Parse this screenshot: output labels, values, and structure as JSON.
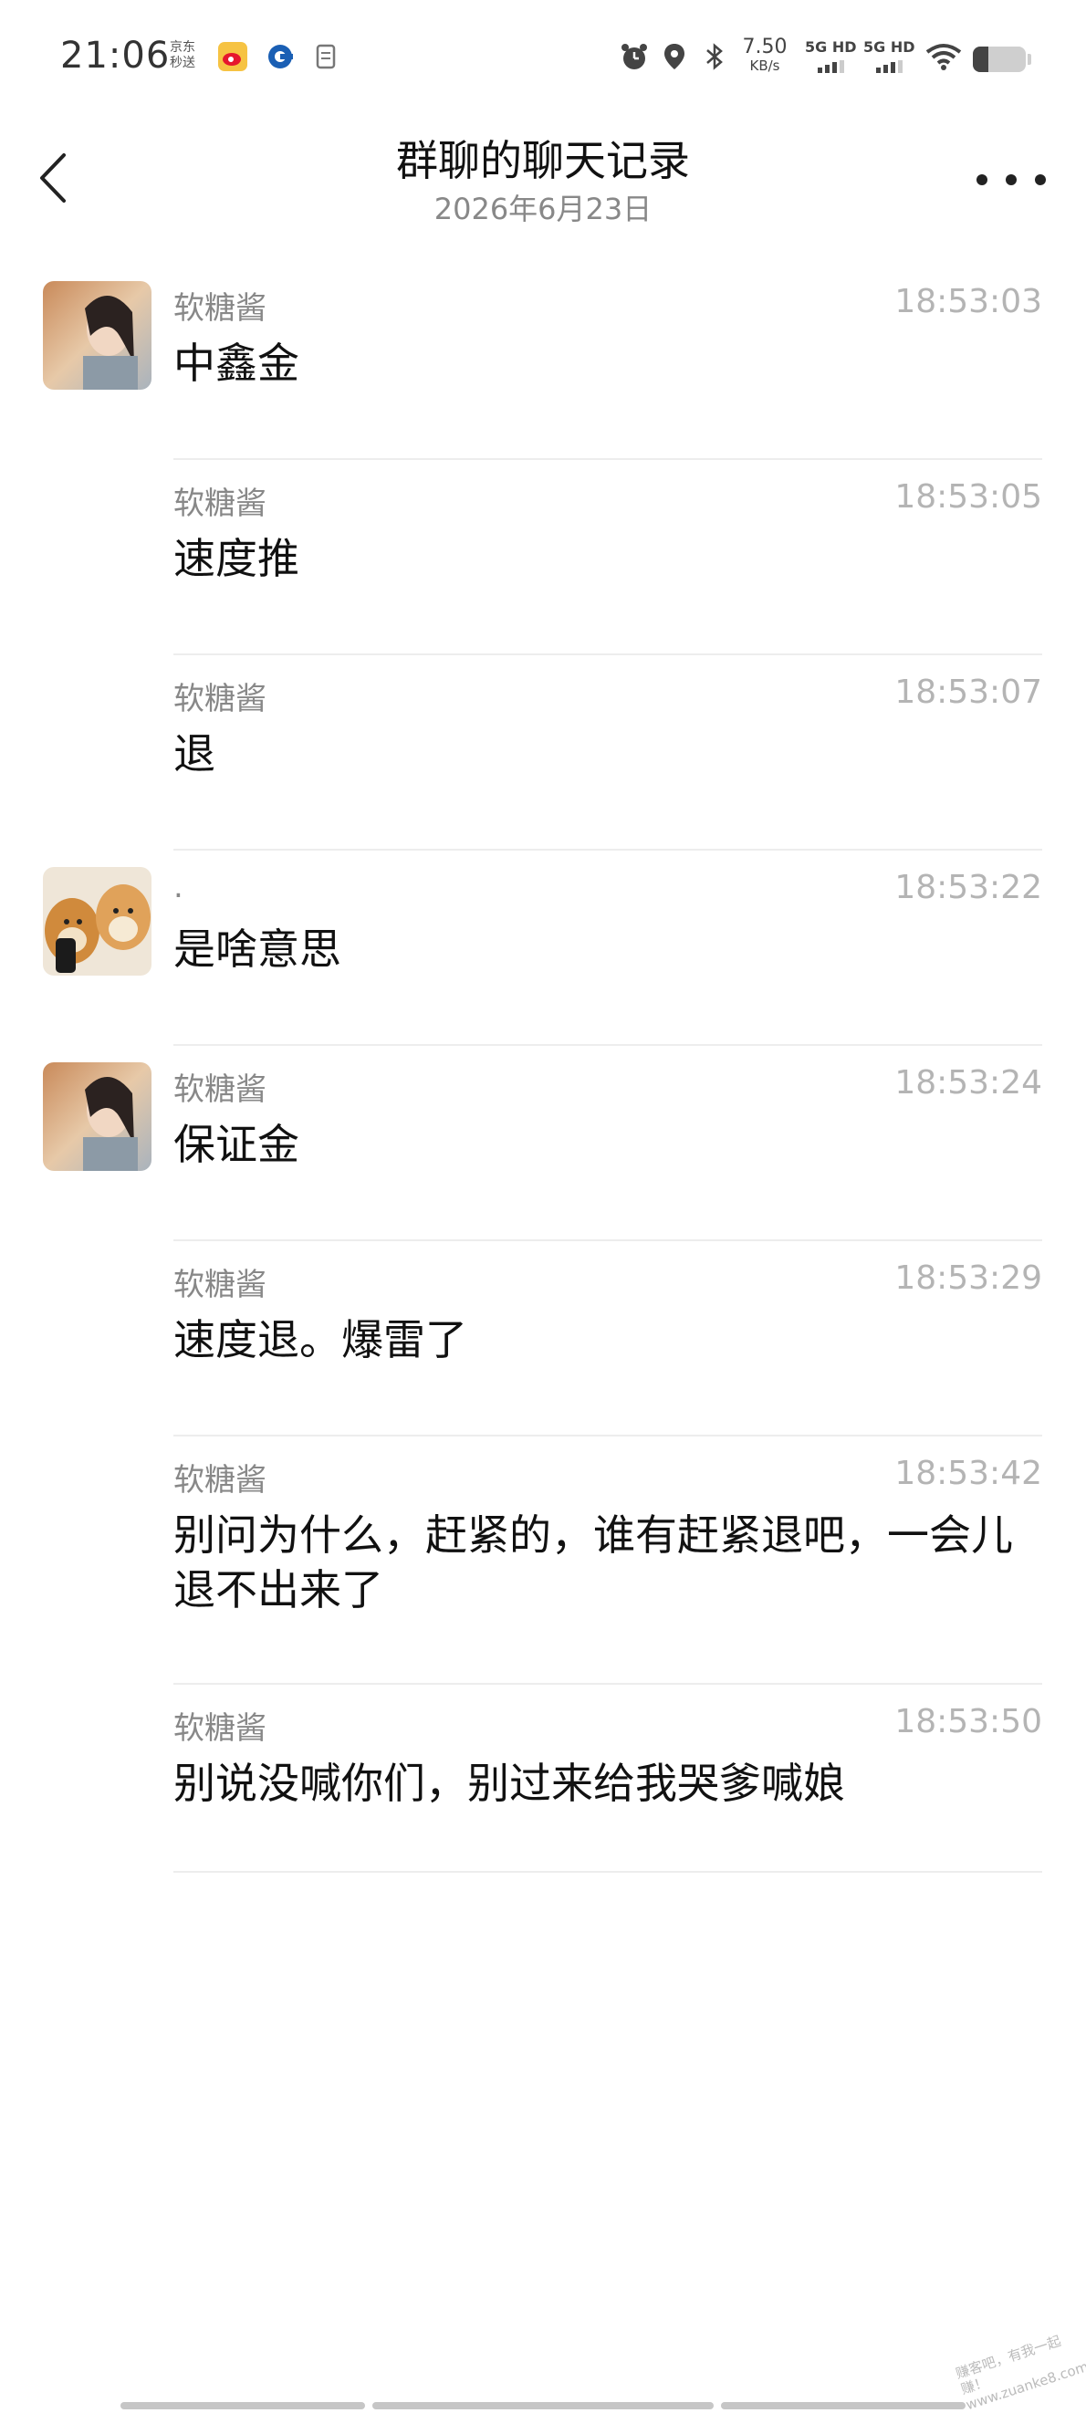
{
  "status_bar": {
    "time": "21:06",
    "left_text": [
      "京东",
      "秒送"
    ],
    "speed_value": "7.50",
    "speed_unit": "KB/s",
    "sim1": "5G HD",
    "sim2": "5G HD",
    "battery_level": 0.3,
    "icons": [
      "weibo-icon",
      "app-icon",
      "document-icon",
      "alarm-icon",
      "location-icon",
      "bluetooth-icon",
      "wifi-icon",
      "battery-icon"
    ]
  },
  "header": {
    "title": "群聊的聊天记录",
    "subtitle": "2026年6月23日"
  },
  "messages": [
    {
      "sender": "软糖酱",
      "time": "18:53:03",
      "text": "中鑫金",
      "avatar": "girl-photo"
    },
    {
      "sender": "软糖酱",
      "time": "18:53:05",
      "text": "速度推",
      "avatar": ""
    },
    {
      "sender": "软糖酱",
      "time": "18:53:07",
      "text": "退",
      "avatar": ""
    },
    {
      "sender": ".",
      "time": "18:53:22",
      "text": "是啥意思",
      "avatar": "dogs-photo"
    },
    {
      "sender": "软糖酱",
      "time": "18:53:24",
      "text": "保证金",
      "avatar": "girl-photo"
    },
    {
      "sender": "软糖酱",
      "time": "18:53:29",
      "text": "速度退。爆雷了",
      "avatar": ""
    },
    {
      "sender": "软糖酱",
      "time": "18:53:42",
      "text": "别问为什么，赶紧的，谁有赶紧退吧，一会儿退不出来了",
      "avatar": ""
    },
    {
      "sender": "软糖酱",
      "time": "18:53:50",
      "text": "别说没喊你们，别过来给我哭爹喊娘",
      "avatar": ""
    }
  ],
  "watermark": [
    "赚客吧，有我一起赚！",
    "www.zuanke8.com"
  ]
}
